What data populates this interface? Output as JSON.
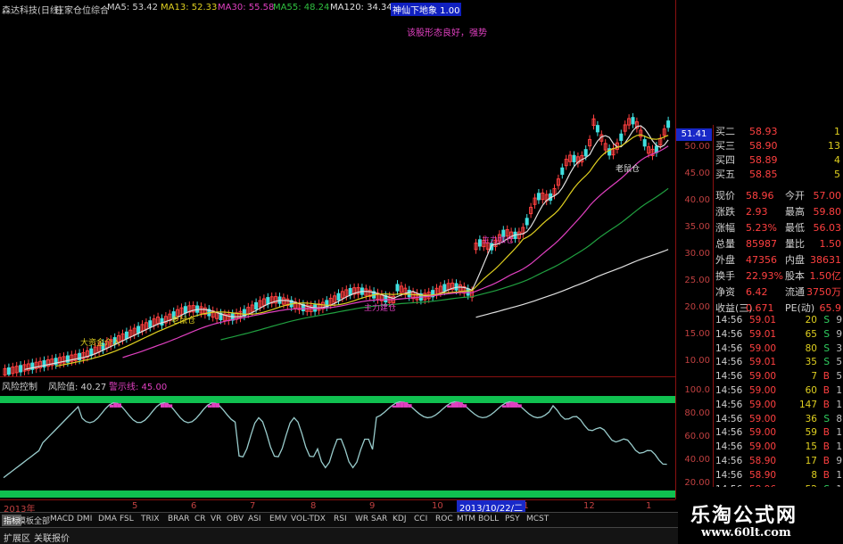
{
  "header": {
    "stock_name": "森达科技(日线)",
    "indicator": "庄家仓位综合",
    "ma5": "MA5: 53.42",
    "ma13": "MA13: 52.33",
    "ma30": "MA30: 55.58",
    "ma55": "MA55: 48.24",
    "ma120": "MA120: 34.34",
    "tag": "神仙下地象 1.00",
    "note": "该股形态良好，强势"
  },
  "price_axis": {
    "current_price_tag": "51.41",
    "ticks": [
      "50.00",
      "45.00",
      "40.00",
      "35.00",
      "30.00",
      "25.00",
      "20.00",
      "15.00",
      "10.00"
    ],
    "osc_ticks": [
      "100.0",
      "80.00",
      "60.00",
      "40.00",
      "20.00"
    ]
  },
  "chart_labels": {
    "big_position": "大资金介入",
    "mouse_1": "老鼠仓",
    "mouse_2": "老鼠仓",
    "mouse_3": "老鼠仓",
    "jump": "拉升",
    "main_entry": "主力建仓",
    "main_entry_2": "主力加仓"
  },
  "oscillator": {
    "title": "风险控制",
    "risk_value": "风险值: 40.27",
    "warn_line": "警示线: 45.00"
  },
  "date_axis": {
    "year_label": "2013年",
    "months": [
      "5",
      "6",
      "7",
      "8",
      "9",
      "10",
      "11",
      "12",
      "1"
    ],
    "cursor_date": "2013/10/22/二"
  },
  "quote": {
    "bids": [
      {
        "label": "买二",
        "price": "58.93",
        "vol": "1"
      },
      {
        "label": "买三",
        "price": "58.90",
        "vol": "13"
      },
      {
        "label": "买四",
        "price": "58.89",
        "vol": "4"
      },
      {
        "label": "买五",
        "price": "58.85",
        "vol": "5"
      }
    ],
    "stats": [
      {
        "l1": "现价",
        "v1": "58.96",
        "l2": "今开",
        "v2": "57.00"
      },
      {
        "l1": "涨跌",
        "v1": "2.93",
        "l2": "最高",
        "v2": "59.80"
      },
      {
        "l1": "涨幅",
        "v1": "5.23%",
        "l2": "最低",
        "v2": "56.03"
      },
      {
        "l1": "总量",
        "v1": "85987",
        "l2": "量比",
        "v2": "1.50"
      },
      {
        "l1": "外盘",
        "v1": "47356",
        "l2": "内盘",
        "v2": "38631"
      }
    ],
    "stats2": [
      {
        "l1": "换手",
        "v1": "22.93%",
        "l2": "股本",
        "v2": "1.50亿"
      },
      {
        "l1": "净资",
        "v1": "6.42",
        "l2": "流通",
        "v2": "3750万"
      },
      {
        "l1": "收益(三)",
        "v1": "0.671",
        "l2": "PE(动)",
        "v2": "65.9"
      }
    ],
    "ticks": [
      {
        "time": "14:56",
        "price": "59.01",
        "vol": "20",
        "side": "S",
        "extra": "9"
      },
      {
        "time": "14:56",
        "price": "59.01",
        "vol": "65",
        "side": "S",
        "extra": "9"
      },
      {
        "time": "14:56",
        "price": "59.00",
        "vol": "80",
        "side": "S",
        "extra": "3"
      },
      {
        "time": "14:56",
        "price": "59.01",
        "vol": "35",
        "side": "S",
        "extra": "5"
      },
      {
        "time": "14:56",
        "price": "59.00",
        "vol": "7",
        "side": "B",
        "extra": "5"
      },
      {
        "time": "14:56",
        "price": "59.00",
        "vol": "60",
        "side": "B",
        "extra": "1"
      },
      {
        "time": "14:56",
        "price": "59.00",
        "vol": "147",
        "side": "B",
        "extra": "1"
      },
      {
        "time": "14:56",
        "price": "59.00",
        "vol": "36",
        "side": "S",
        "extra": "8"
      },
      {
        "time": "14:56",
        "price": "59.00",
        "vol": "59",
        "side": "B",
        "extra": "1"
      },
      {
        "time": "14:56",
        "price": "59.00",
        "vol": "15",
        "side": "B",
        "extra": "1"
      },
      {
        "time": "14:56",
        "price": "58.90",
        "vol": "17",
        "side": "B",
        "extra": "9"
      },
      {
        "time": "14:56",
        "price": "58.90",
        "vol": "8",
        "side": "B",
        "extra": "1"
      },
      {
        "time": "14:56",
        "price": "58.96",
        "vol": "52",
        "side": "S",
        "extra": "1"
      },
      {
        "time": "14:56",
        "price": "58.90",
        "vol": "25",
        "side": "S",
        "extra": "2"
      },
      {
        "time": "14:56",
        "price": "58.96",
        "vol": "10",
        "side": "S",
        "extra": "5"
      }
    ]
  },
  "tabs": [
    "指标",
    "模板",
    "全部",
    "MACD",
    "DMI",
    "DMA",
    "FSL",
    "TRIX",
    "BRAR",
    "CR",
    "VR",
    "OBV",
    "ASI",
    "EMV",
    "VOL-TDX",
    "RSI",
    "WR",
    "SAR",
    "KDJ",
    "CCI",
    "ROC",
    "MTM",
    "BOLL",
    "PSY",
    "MCST"
  ],
  "status": {
    "expand": "扩展区",
    "related": "关联报价"
  },
  "brand": {
    "name": "乐淘公式网",
    "url": "www.60lt.com"
  },
  "colors": {
    "background": "#000000",
    "axis_red": "#c04040",
    "up_red": "#ff4040",
    "down_cyan": "#40e0e0",
    "osc_band": "#10c050",
    "osc_line": "#9cc",
    "peak_magenta": "#e040c0",
    "ma_white": "#e0e0e0",
    "ma_green": "#20a040",
    "ma_magenta": "#c030c0",
    "text_yellow": "#e0d020"
  }
}
